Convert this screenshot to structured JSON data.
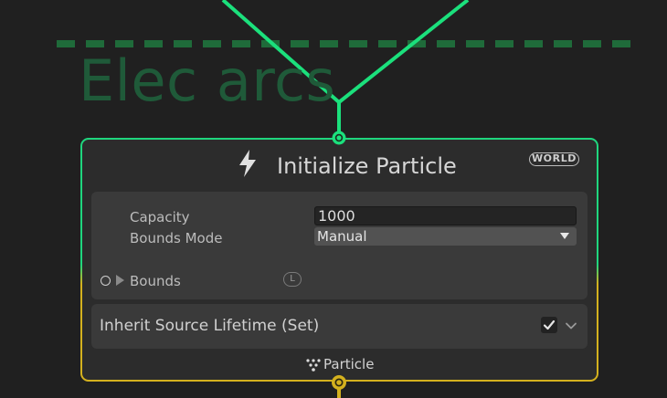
{
  "group": {
    "title": "Elec arcs"
  },
  "node": {
    "title": "Initialize Particle",
    "space_badge": "WORLD",
    "icon": "lightning-bolt-icon",
    "settings": {
      "capacity_label": "Capacity",
      "capacity_value": "1000",
      "bounds_mode_label": "Bounds Mode",
      "bounds_mode_value": "Manual",
      "bounds_label": "Bounds",
      "bounds_space_badge": "L"
    },
    "blocks": [
      {
        "title": "Inherit Source Lifetime (Set)",
        "enabled": true
      }
    ],
    "output": {
      "label": "Particle",
      "icon": "particle-icon"
    }
  },
  "colors": {
    "background": "#202020",
    "spawn_flow": "#1be07c",
    "particle_flow": "#d4b11e",
    "group_border": "#1f6b3a",
    "group_title": "#1f5a39"
  }
}
